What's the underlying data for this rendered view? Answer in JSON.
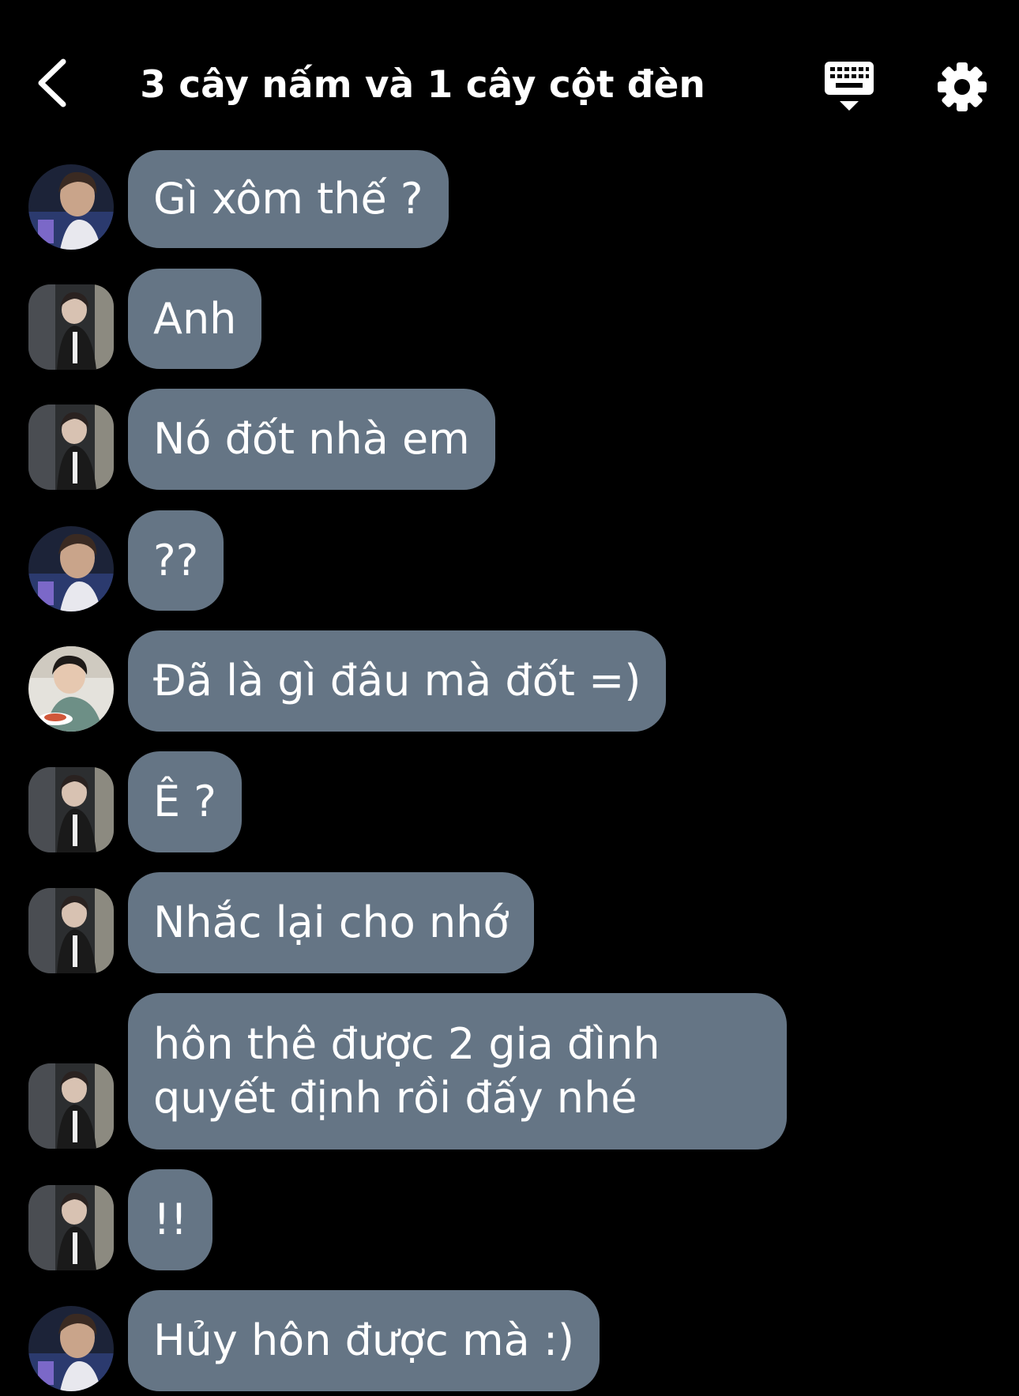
{
  "header": {
    "title": "3 cây nấm và 1 cây cột đèn",
    "back_icon": "chevron-left-icon",
    "keyboard_icon": "keyboard-hide-icon",
    "settings_icon": "gear-icon"
  },
  "colors": {
    "background": "#000000",
    "bubble": "#657585",
    "text": "#ffffff"
  },
  "messages": [
    {
      "text": "Gì xôm thế ?",
      "avatar": "avatar-a"
    },
    {
      "text": "Anh",
      "avatar": "avatar-b"
    },
    {
      "text": "Nó đốt nhà em",
      "avatar": "avatar-b"
    },
    {
      "text": "??",
      "avatar": "avatar-a"
    },
    {
      "text": "Đã là gì đâu mà đốt =)",
      "avatar": "avatar-c"
    },
    {
      "text": "Ê ?",
      "avatar": "avatar-b"
    },
    {
      "text": "Nhắc lại cho nhớ",
      "avatar": "avatar-b"
    },
    {
      "text": "hôn thê được 2 gia đình\nquyết định rồi đấy nhé",
      "avatar": "avatar-b"
    },
    {
      "text": "!!",
      "avatar": "avatar-b"
    },
    {
      "text": "Hủy hôn được mà :)",
      "avatar": "avatar-a"
    }
  ]
}
